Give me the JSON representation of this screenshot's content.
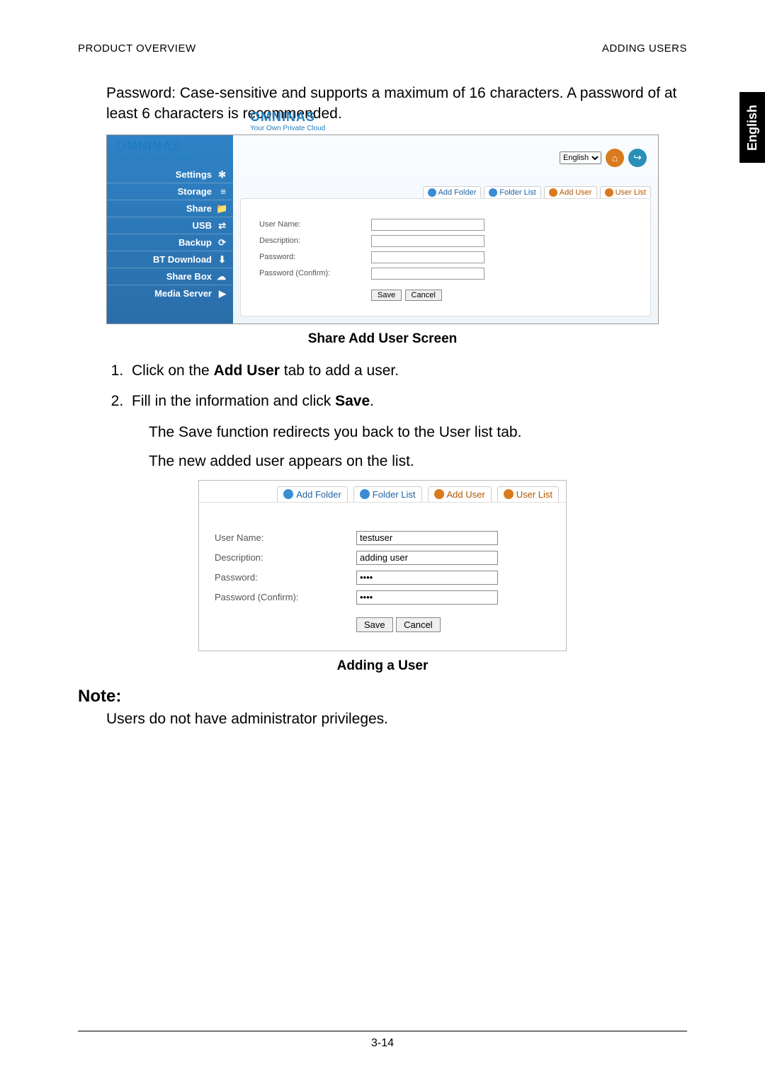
{
  "header": {
    "left": "PRODUCT OVERVIEW",
    "right": "ADDING USERS"
  },
  "side_tab": "English",
  "intro_text": "Password: Case-sensitive and supports a maximum of 16 characters. A password of at least 6 characters is recommended.",
  "screenshot1": {
    "logo": {
      "name": "OMNINAS",
      "tagline": "Your Own Private Cloud"
    },
    "language_label": "English",
    "nav": [
      {
        "label": "Settings",
        "icon": "gear-icon"
      },
      {
        "label": "Storage",
        "icon": "storage-icon"
      },
      {
        "label": "Share",
        "icon": "share-icon"
      },
      {
        "label": "USB",
        "icon": "usb-icon"
      },
      {
        "label": "Backup",
        "icon": "backup-icon"
      },
      {
        "label": "BT Download",
        "icon": "download-icon"
      },
      {
        "label": "Share Box",
        "icon": "box-icon"
      },
      {
        "label": "Media Server",
        "icon": "media-icon"
      }
    ],
    "tabs": {
      "add_folder": "Add Folder",
      "folder_list": "Folder List",
      "add_user": "Add User",
      "user_list": "User List"
    },
    "form": {
      "user_name_label": "User Name:",
      "description_label": "Description:",
      "password_label": "Password:",
      "password_confirm_label": "Password (Confirm):",
      "user_name_value": "",
      "description_value": "",
      "password_value": "",
      "password_confirm_value": "",
      "save": "Save",
      "cancel": "Cancel"
    }
  },
  "caption1": "Share Add User Screen",
  "steps": {
    "s1_pre": "Click on the ",
    "s1_bold": "Add User",
    "s1_post": " tab to add a user.",
    "s2_pre": "Fill in the information and click ",
    "s2_bold": "Save",
    "s2_post": "."
  },
  "sub1": "The Save function redirects you back to the User list tab.",
  "sub2": "The new added user appears on the list.",
  "screenshot2": {
    "tabs": {
      "add_folder": "Add Folder",
      "folder_list": "Folder List",
      "add_user": "Add User",
      "user_list": "User List"
    },
    "form": {
      "user_name_label": "User Name:",
      "description_label": "Description:",
      "password_label": "Password:",
      "password_confirm_label": "Password (Confirm):",
      "user_name_value": "testuser",
      "description_value": "adding user",
      "password_value": "••••",
      "password_confirm_value": "••••",
      "save": "Save",
      "cancel": "Cancel"
    }
  },
  "caption2": "Adding a User",
  "note": {
    "heading": "Note:",
    "body": "Users do not have administrator privileges."
  },
  "page_number": "3-14"
}
